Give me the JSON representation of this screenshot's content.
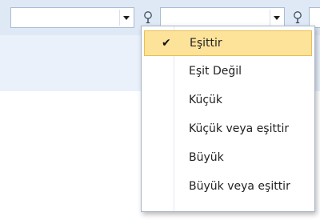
{
  "filter_bar": {
    "combo_1": {
      "value": ""
    },
    "combo_2": {
      "value": ""
    }
  },
  "condition_menu": {
    "items": [
      {
        "label": "Eşittir",
        "checked": true
      },
      {
        "label": "Eşit Değil",
        "checked": false
      },
      {
        "label": "Küçük",
        "checked": false
      },
      {
        "label": "Küçük veya eşittir",
        "checked": false
      },
      {
        "label": "Büyük",
        "checked": false
      },
      {
        "label": "Büyük veya eşittir",
        "checked": false
      }
    ],
    "check_glyph": "✔"
  },
  "colors": {
    "highlight": "#fde39a",
    "highlight_border": "#e9bf52",
    "toolbar": "#dfe9f6"
  }
}
